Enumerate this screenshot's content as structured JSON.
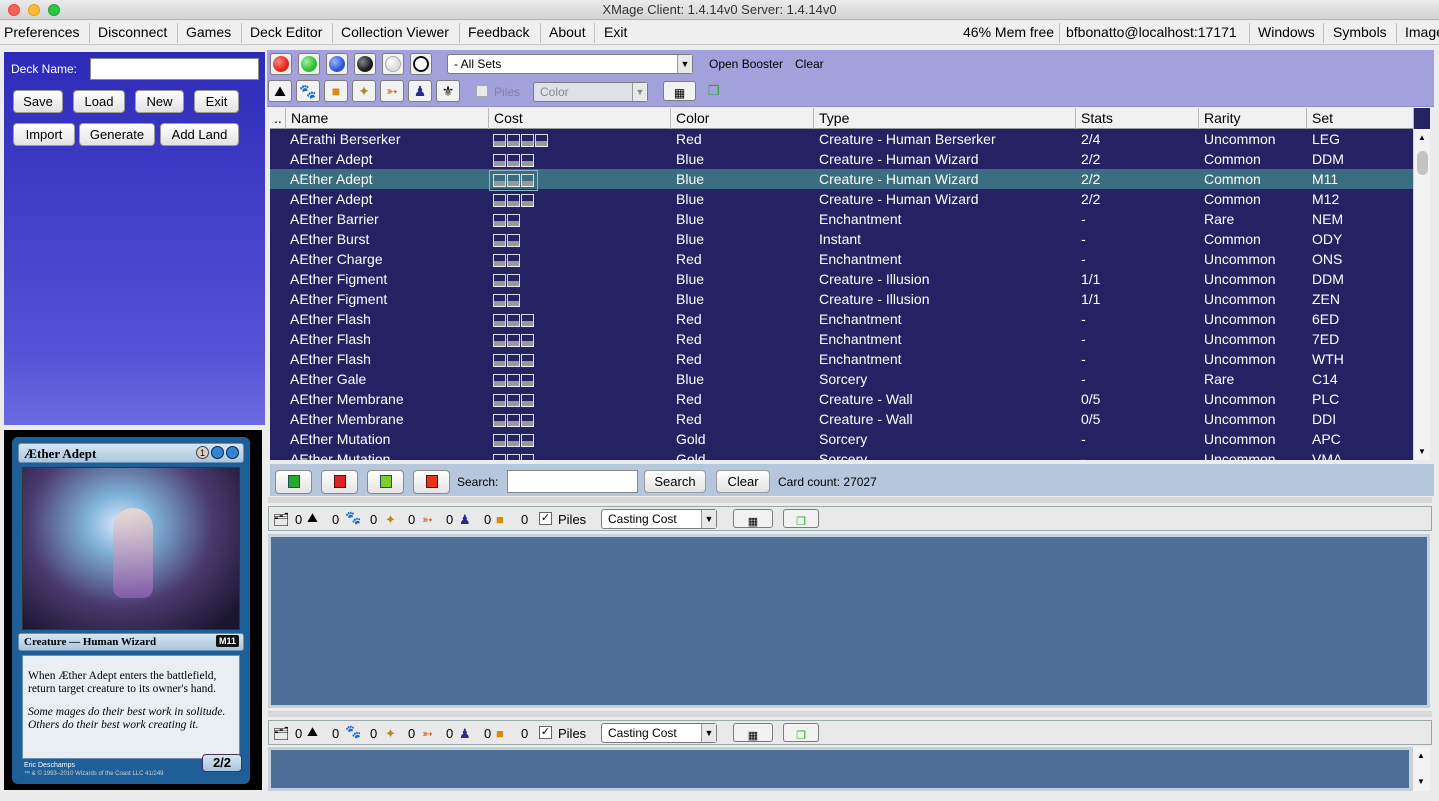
{
  "window": {
    "title": "XMage  Client: 1.4.14v0  Server: 1.4.14v0"
  },
  "menu": {
    "items": [
      "Preferences",
      "Disconnect",
      "Games",
      "Deck Editor",
      "Collection Viewer",
      "Feedback",
      "About",
      "Exit"
    ],
    "right": [
      "46% Mem free",
      "bfbonatto@localhost:17171",
      "Windows",
      "Symbols",
      "Images"
    ]
  },
  "deck": {
    "name_label": "Deck Name:",
    "name_value": "",
    "buttons": [
      "Save",
      "Load",
      "New",
      "Exit",
      "Import",
      "Generate",
      "Add Land"
    ]
  },
  "filters": {
    "set_select": "- All Sets",
    "open_booster": "Open Booster",
    "clear": "Clear",
    "piles": "Piles",
    "color_select": "Color"
  },
  "colors": {
    "red": "#e2231a",
    "green": "#2ebd2e",
    "blue": "#2a57d9",
    "black": "#1a1a1a",
    "white": "#f5f5f5"
  },
  "table": {
    "columns": [
      "..",
      "Name",
      "Cost",
      "Color",
      "Type",
      "Stats",
      "Rarity",
      "Set"
    ],
    "rows": [
      {
        "name": "AErathi Berserker",
        "cost": 4,
        "color": "Red",
        "type": "Creature - Human Berserker",
        "stats": "2/4",
        "rarity": "Uncommon",
        "set": "LEG"
      },
      {
        "name": "AEther Adept",
        "cost": 3,
        "color": "Blue",
        "type": "Creature - Human Wizard",
        "stats": "2/2",
        "rarity": "Common",
        "set": "DDM"
      },
      {
        "name": "AEther Adept",
        "cost": 3,
        "color": "Blue",
        "type": "Creature - Human Wizard",
        "stats": "2/2",
        "rarity": "Common",
        "set": "M11"
      },
      {
        "name": "AEther Adept",
        "cost": 3,
        "color": "Blue",
        "type": "Creature - Human Wizard",
        "stats": "2/2",
        "rarity": "Common",
        "set": "M12"
      },
      {
        "name": "AEther Barrier",
        "cost": 2,
        "color": "Blue",
        "type": "Enchantment",
        "stats": "-",
        "rarity": "Rare",
        "set": "NEM"
      },
      {
        "name": "AEther Burst",
        "cost": 2,
        "color": "Blue",
        "type": "Instant",
        "stats": "-",
        "rarity": "Common",
        "set": "ODY"
      },
      {
        "name": "AEther Charge",
        "cost": 2,
        "color": "Red",
        "type": "Enchantment",
        "stats": "-",
        "rarity": "Uncommon",
        "set": "ONS"
      },
      {
        "name": "AEther Figment",
        "cost": 2,
        "color": "Blue",
        "type": "Creature - Illusion",
        "stats": "1/1",
        "rarity": "Uncommon",
        "set": "DDM"
      },
      {
        "name": "AEther Figment",
        "cost": 2,
        "color": "Blue",
        "type": "Creature - Illusion",
        "stats": "1/1",
        "rarity": "Uncommon",
        "set": "ZEN"
      },
      {
        "name": "AEther Flash",
        "cost": 3,
        "color": "Red",
        "type": "Enchantment",
        "stats": "-",
        "rarity": "Uncommon",
        "set": "6ED"
      },
      {
        "name": "AEther Flash",
        "cost": 3,
        "color": "Red",
        "type": "Enchantment",
        "stats": "-",
        "rarity": "Uncommon",
        "set": "7ED"
      },
      {
        "name": "AEther Flash",
        "cost": 3,
        "color": "Red",
        "type": "Enchantment",
        "stats": "-",
        "rarity": "Uncommon",
        "set": "WTH"
      },
      {
        "name": "AEther Gale",
        "cost": 3,
        "color": "Blue",
        "type": "Sorcery",
        "stats": "-",
        "rarity": "Rare",
        "set": "C14"
      },
      {
        "name": "AEther Membrane",
        "cost": 3,
        "color": "Red",
        "type": "Creature - Wall",
        "stats": "0/5",
        "rarity": "Uncommon",
        "set": "PLC"
      },
      {
        "name": "AEther Membrane",
        "cost": 3,
        "color": "Red",
        "type": "Creature - Wall",
        "stats": "0/5",
        "rarity": "Uncommon",
        "set": "DDI"
      },
      {
        "name": "AEther Mutation",
        "cost": 3,
        "color": "Gold",
        "type": "Sorcery",
        "stats": "-",
        "rarity": "Uncommon",
        "set": "APC"
      },
      {
        "name": "AEther Mutation",
        "cost": 3,
        "color": "Gold",
        "type": "Sorcery",
        "stats": "-",
        "rarity": "Uncommon",
        "set": "VMA"
      }
    ],
    "selected_index": 2
  },
  "search": {
    "label": "Search:",
    "value": "",
    "search_button": "Search",
    "clear_button": "Clear",
    "count_label": "Card count:",
    "count": "27027"
  },
  "deck_panel": {
    "counts": [
      "0",
      "0",
      "0",
      "0",
      "0",
      "0",
      "0"
    ],
    "piles": "Piles",
    "sort": "Casting Cost"
  },
  "side_panel": {
    "counts": [
      "0",
      "0",
      "0",
      "0",
      "0",
      "0",
      "0"
    ],
    "piles": "Piles",
    "sort": "Casting Cost"
  },
  "card": {
    "name": "Æther Adept",
    "mana": "1",
    "type_line": "Creature — Human Wizard",
    "set": "M11",
    "rules": "When Æther Adept enters the battlefield, return target creature to its owner's hand.",
    "flavor": "Some mages do their best work in solitude. Others do their best work creating it.",
    "pt": "2/2",
    "artist": "Eric Deschamps",
    "copyright": "™ & © 1993–2010 Wizards of the Coast LLC 41/249"
  }
}
